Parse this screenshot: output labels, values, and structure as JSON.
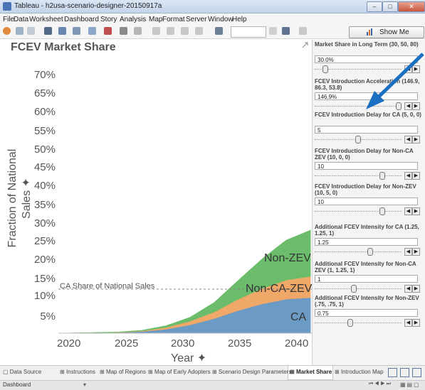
{
  "window": {
    "title": "Tableau - h2usa-scenario-designer-20150917a"
  },
  "menu": [
    "File",
    "Data",
    "Worksheet",
    "Dashboard",
    "Story",
    "Analysis",
    "Map",
    "Format",
    "Server",
    "Window",
    "Help"
  ],
  "toolbar": {
    "show_me_label": "Show Me"
  },
  "sheet": {
    "title": "FCEV Market Share"
  },
  "chart_data": {
    "type": "area",
    "title": "FCEV Market Share",
    "xlabel": "Year",
    "ylabel": "Fraction of National Sales",
    "x_ticks": [
      "2020",
      "2025",
      "2030",
      "2035",
      "2040"
    ],
    "y_ticks": [
      "5%",
      "10%",
      "15%",
      "20%",
      "25%",
      "30%",
      "35%",
      "40%",
      "45%",
      "50%",
      "55%",
      "60%",
      "65%",
      "70%"
    ],
    "xlim": [
      2020,
      2040
    ],
    "ylim": [
      0,
      70
    ],
    "stacked": true,
    "x": [
      2020,
      2022,
      2024,
      2026,
      2028,
      2030,
      2032,
      2034,
      2036,
      2038,
      2040
    ],
    "series": [
      {
        "name": "CA",
        "color": "#6b9ac4",
        "values": [
          0,
          0.1,
          0.2,
          0.5,
          1.1,
          2.3,
          4.0,
          6.2,
          8.0,
          9.3,
          9.7
        ]
      },
      {
        "name": "Non-CA-ZEV",
        "color": "#f0a868",
        "values": [
          0,
          0.02,
          0.05,
          0.15,
          0.5,
          1.0,
          1.8,
          3.1,
          4.2,
          5.2,
          5.8
        ]
      },
      {
        "name": "Non-ZEV",
        "color": "#6bbd6b",
        "values": [
          0,
          0.01,
          0.03,
          0.1,
          0.4,
          1.0,
          2.5,
          5.0,
          8.0,
          10.8,
          12.5
        ]
      }
    ],
    "reference_line": {
      "label": "CA Share of National Sales",
      "value": 12.0
    },
    "grid": false,
    "legend": "none"
  },
  "parameters": [
    {
      "title": "Market Share in Long Term (30, 50, 80)",
      "value": "30.0%",
      "slider": 0.1
    },
    {
      "title": "FCEV Introduction Acceleration (146.9, 86.3, 53.8)",
      "value": "146.9%",
      "slider": 1.0
    },
    {
      "title": "FCEV Introduction Delay for CA (5, 0, 0)",
      "value": "5",
      "slider": 0.5
    },
    {
      "title": "FCEV Introduction Delay for Non-CA ZEV (10, 0, 0)",
      "value": "10",
      "slider": 0.8
    },
    {
      "title": "FCEV Introduction Delay for Non-ZEV (10, 5, 0)",
      "value": "10",
      "slider": 0.8
    },
    {
      "title": "Additional FCEV Intensity for CA (1.25, 1.25, 1)",
      "value": "1.25",
      "slider": 0.65
    },
    {
      "title": "Additional FCEV Intensity for Non-CA ZEV (1, 1.25, 1)",
      "value": "1",
      "slider": 0.45
    },
    {
      "title": "Additional FCEV Intensity for Non-ZEV (.75, .75, 1)",
      "value": "0.75",
      "slider": 0.4
    }
  ],
  "tabs": [
    "Data Source",
    "Instructions",
    "Map of Regions",
    "Map of Early Adopters",
    "Scenario Design Parameters",
    "Market Share",
    "Introduction Map"
  ],
  "active_tab": "Market Share",
  "status": {
    "text": "Dashboard"
  },
  "colors": {
    "annotation_arrow": "#1a6fc0"
  }
}
